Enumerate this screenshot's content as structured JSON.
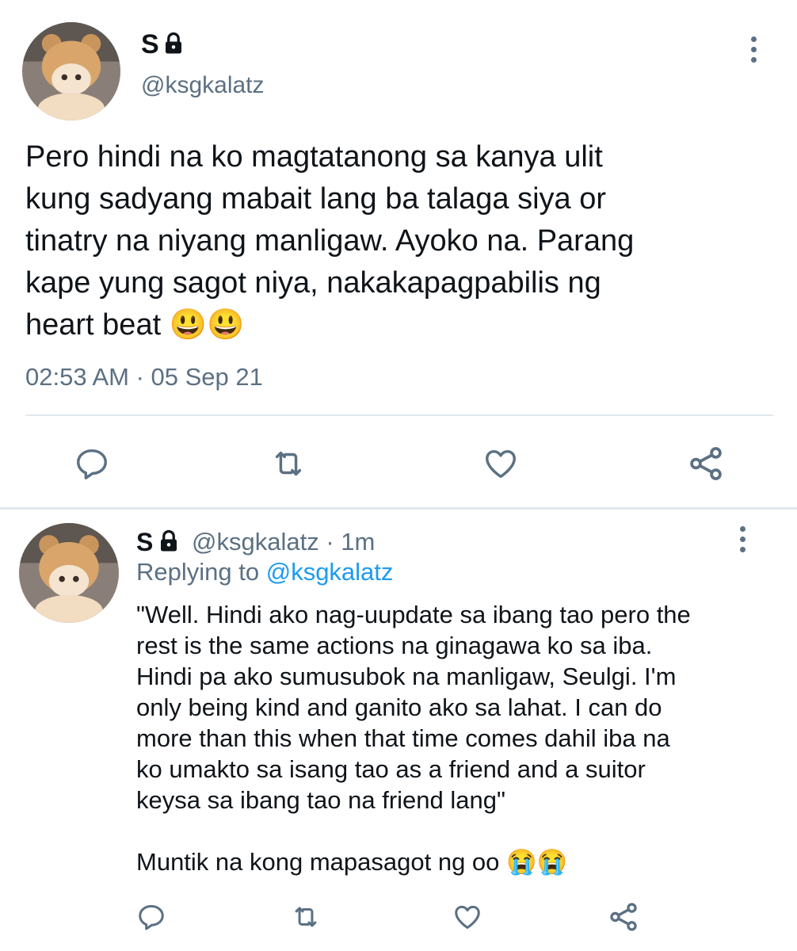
{
  "tweet": {
    "display_name": "S",
    "handle": "@ksgkalatz",
    "body": "Pero hindi na ko magtatanong sa kanya ulit\nkung sadyang mabait lang ba talaga siya or\ntinatry na niyang manligaw. Ayoko na. Parang\nkape yung sagot niya, nakakapagpabilis ng\nheart beat",
    "emojis": [
      "😃",
      "😃"
    ],
    "timestamp": "02:53 AM · 05 Sep 21"
  },
  "reply": {
    "display_name": "S",
    "handle": "@ksgkalatz",
    "time": "· 1m",
    "replying_prefix": "Replying to",
    "replying_handle": "@ksgkalatz",
    "body": "\"Well. Hindi ako nag-uupdate sa ibang tao pero the\nrest is the same actions na ginagawa ko sa iba.\nHindi pa ako sumusubok na manligaw, Seulgi. I'm\nonly being kind and ganito ako sa lahat. I can do\nmore than this when that time comes dahil iba na\nko umakto sa isang tao as a friend and a suitor\nkeysa sa ibang tao na friend lang\"",
    "body2": "Muntik na kong mapasagot ng oo",
    "emojis": [
      "😭",
      "😭"
    ]
  },
  "icons": {
    "lock": "lock-icon",
    "more": "more-options-icon",
    "reply": "reply-icon",
    "retweet": "retweet-icon",
    "like": "heart-icon",
    "share": "share-icon"
  },
  "colors": {
    "text": "#0f1419",
    "muted": "#5b7083",
    "link": "#1d9bf0",
    "divider": "#e1e8ed"
  }
}
